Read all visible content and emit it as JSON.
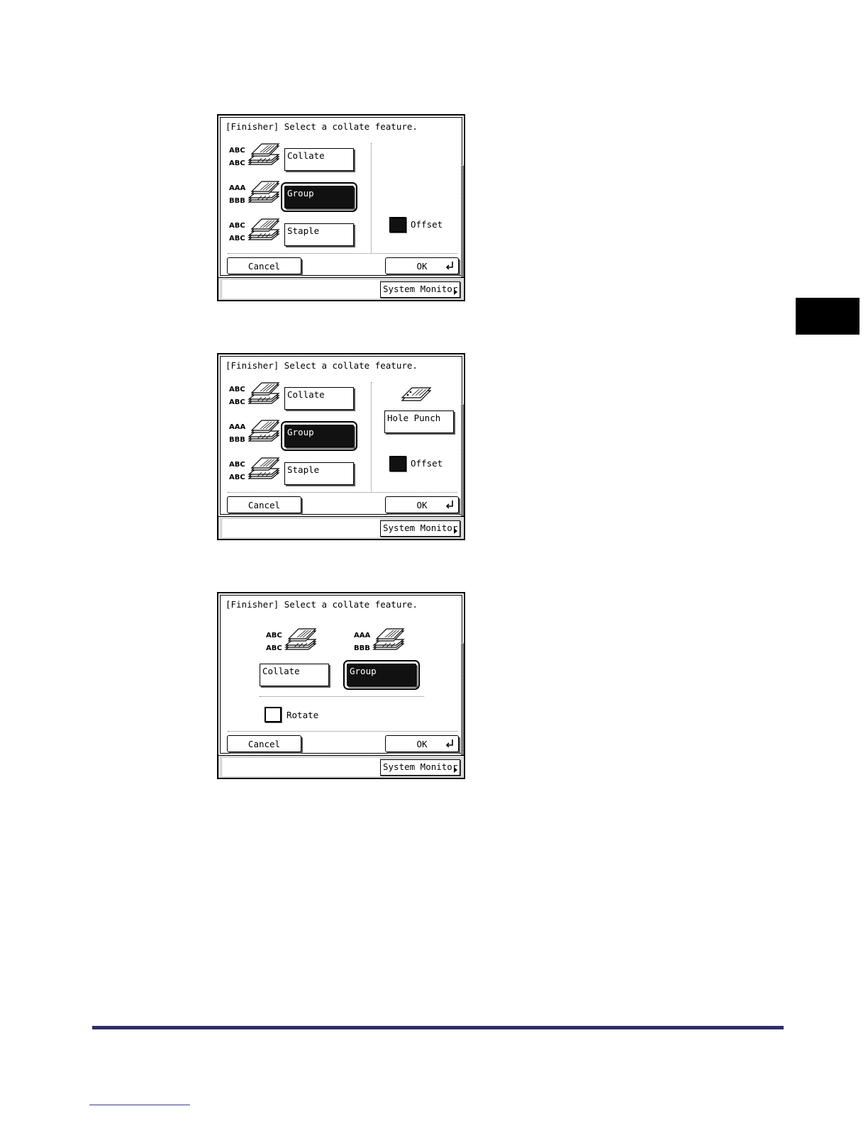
{
  "panels": [
    {
      "title": "[Finisher] Select a collate feature.",
      "options": [
        {
          "labels": [
            "ABC",
            "ABC"
          ],
          "button": "Collate",
          "selected": false
        },
        {
          "labels": [
            "AAA",
            "BBB"
          ],
          "button": "Group",
          "selected": true
        },
        {
          "labels": [
            "ABC",
            "ABC"
          ],
          "button": "Staple",
          "selected": false
        }
      ],
      "offset_label": "Offset",
      "offset_checked": true,
      "cancel": "Cancel",
      "ok": "OK",
      "system_monitor": "System Monitor"
    },
    {
      "title": "[Finisher] Select a collate feature.",
      "options": [
        {
          "labels": [
            "ABC",
            "ABC"
          ],
          "button": "Collate",
          "selected": false
        },
        {
          "labels": [
            "AAA",
            "BBB"
          ],
          "button": "Group",
          "selected": true
        },
        {
          "labels": [
            "ABC",
            "ABC"
          ],
          "button": "Staple",
          "selected": false
        }
      ],
      "hole_punch": "Hole Punch",
      "offset_label": "Offset",
      "offset_checked": true,
      "cancel": "Cancel",
      "ok": "OK",
      "system_monitor": "System Monitor"
    },
    {
      "title": "[Finisher] Select a collate feature.",
      "options": [
        {
          "labels": [
            "ABC",
            "ABC"
          ],
          "button": "Collate",
          "selected": false
        },
        {
          "labels": [
            "AAA",
            "BBB"
          ],
          "button": "Group",
          "selected": true
        }
      ],
      "rotate_label": "Rotate",
      "rotate_checked": false,
      "cancel": "Cancel",
      "ok": "OK",
      "system_monitor": "System Monitor"
    }
  ]
}
